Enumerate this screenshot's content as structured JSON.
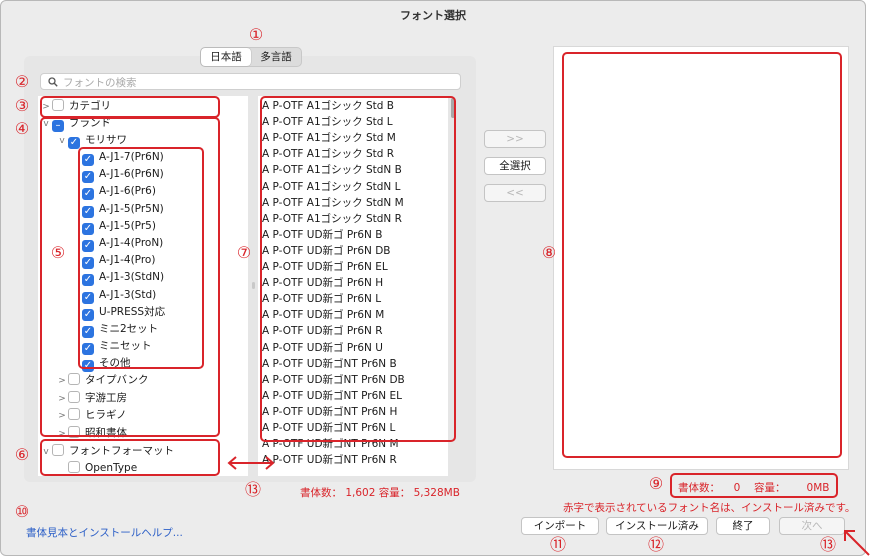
{
  "window": {
    "title": "フォント選択"
  },
  "language_tabs": [
    {
      "label": "日本語",
      "selected": true
    },
    {
      "label": "多言語",
      "selected": false
    }
  ],
  "search": {
    "placeholder": "フォントの検索"
  },
  "tree": {
    "category": "カテゴリ",
    "brand": "ブランド",
    "morisawa": "モリサワ",
    "subsets": [
      "A-J1-7(Pr6N)",
      "A-J1-6(Pr6N)",
      "A-J1-6(Pr6)",
      "A-J1-5(Pr5N)",
      "A-J1-5(Pr5)",
      "A-J1-4(ProN)",
      "A-J1-4(Pro)",
      "A-J1-3(StdN)",
      "A-J1-3(Std)",
      "U-PRESS対応",
      "ミニ2セット",
      "ミニセット",
      "その他"
    ],
    "other_brands": [
      "タイプバンク",
      "字游工房",
      "ヒラギノ",
      "昭和書体"
    ],
    "format": "フォントフォーマット",
    "opentype": "OpenType"
  },
  "fonts": [
    "A P-OTF A1ゴシック Std B",
    "A P-OTF A1ゴシック Std L",
    "A P-OTF A1ゴシック Std M",
    "A P-OTF A1ゴシック Std R",
    "A P-OTF A1ゴシック StdN B",
    "A P-OTF A1ゴシック StdN L",
    "A P-OTF A1ゴシック StdN M",
    "A P-OTF A1ゴシック StdN R",
    "A P-OTF UD新ゴ Pr6N B",
    "A P-OTF UD新ゴ Pr6N DB",
    "A P-OTF UD新ゴ Pr6N EL",
    "A P-OTF UD新ゴ Pr6N H",
    "A P-OTF UD新ゴ Pr6N L",
    "A P-OTF UD新ゴ Pr6N M",
    "A P-OTF UD新ゴ Pr6N R",
    "A P-OTF UD新ゴ Pr6N U",
    "A P-OTF UD新ゴNT Pr6N B",
    "A P-OTF UD新ゴNT Pr6N DB",
    "A P-OTF UD新ゴNT Pr6N EL",
    "A P-OTF UD新ゴNT Pr6N H",
    "A P-OTF UD新ゴNT Pr6N L",
    "A P-OTF UD新ゴNT Pr6N M",
    "A P-OTF UD新ゴNT Pr6N R"
  ],
  "transfer_buttons": {
    "add": ">>",
    "select_all": "全選択",
    "remove": "<<"
  },
  "left_count": "書体数： 1,602  容量： 5,328MB",
  "right_count": {
    "label_count": "書体数：",
    "count": "0",
    "label_size": "容量：",
    "size": "0MB"
  },
  "installed_note": "赤字で表示されているフォント名は、インストール済みです。",
  "help_link": "書体見本とインストールヘルプ...",
  "buttons": {
    "import": "インポート",
    "installed": "インストール済み",
    "quit": "終了",
    "next": "次へ"
  },
  "annotations": [
    "①",
    "②",
    "③",
    "④",
    "⑤",
    "⑥",
    "⑦",
    "⑧",
    "⑨",
    "⑩",
    "⑪",
    "⑫",
    "⑬"
  ],
  "colors": {
    "annotation_red": "#d9242a",
    "checkbox_blue": "#2c74e0",
    "link_blue": "#2c5fc7"
  }
}
